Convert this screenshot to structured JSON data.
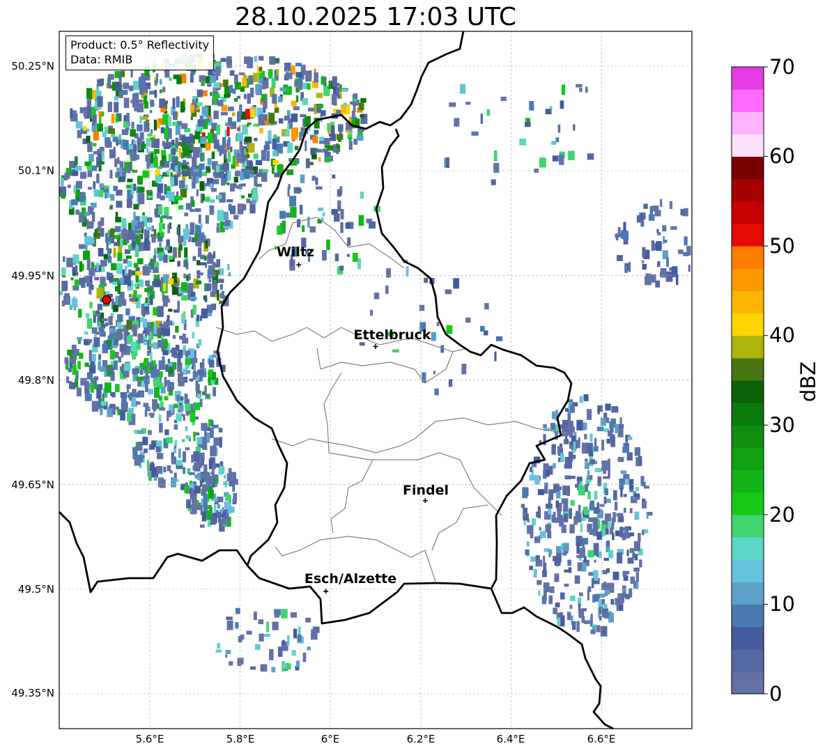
{
  "title": "28.10.2025 17:03 UTC",
  "info": {
    "product": "Product: 0.5° Reflectivity",
    "data": "Data: RMIB"
  },
  "lat_ticks": [
    "50.25°N",
    "50.1°N",
    "49.95°N",
    "49.8°N",
    "49.65°N",
    "49.5°N",
    "49.35°N"
  ],
  "lon_ticks": [
    "5.6°E",
    "5.8°E",
    "6°E",
    "6.2°E",
    "6.4°E",
    "6.6°E"
  ],
  "lat_values": [
    50.25,
    50.1,
    49.95,
    49.8,
    49.65,
    49.5,
    49.35
  ],
  "lon_values": [
    5.6,
    5.8,
    6.0,
    6.2,
    6.4,
    6.6
  ],
  "extent": {
    "lon_min": 5.4,
    "lon_max": 6.8,
    "lat_min": 49.3,
    "lat_max": 50.3
  },
  "colorbar": {
    "label": "dBZ",
    "ticks": [
      "0",
      "10",
      "20",
      "30",
      "40",
      "50",
      "60",
      "70"
    ],
    "colors": [
      "#6271a6",
      "#5567a0",
      "#445c9e",
      "#4a7ab1",
      "#5ba0c8",
      "#64c3dd",
      "#5ed6c5",
      "#3ed66c",
      "#16c917",
      "#12b515",
      "#0fa10f",
      "#0e8d0e",
      "#0c790c",
      "#0b6108",
      "#477611",
      "#adb30a",
      "#fed501",
      "#fdb502",
      "#fe9900",
      "#fe7d00",
      "#e60a02",
      "#c60002",
      "#a60001",
      "#790000",
      "#ffe2ff",
      "#ffb3ff",
      "#ff6bff",
      "#e63be5"
    ]
  },
  "cities": [
    {
      "name": "Wiltz",
      "lon": 5.93,
      "lat": 49.965
    },
    {
      "name": "Ettelbruck",
      "lon": 6.1,
      "lat": 49.848
    },
    {
      "name": "Findel",
      "lon": 6.21,
      "lat": 49.627
    },
    {
      "name": "Esch/Alzette",
      "lon": 5.99,
      "lat": 49.497
    }
  ],
  "radar_site": {
    "lon": 5.505,
    "lat": 49.915,
    "color": "#e00000"
  },
  "echo_regions": [
    {
      "lon": 5.75,
      "lat": 50.18,
      "rlon": 0.33,
      "rlat": 0.09,
      "n": 650,
      "maxI": 20
    },
    {
      "lon": 5.62,
      "lat": 50.08,
      "rlon": 0.22,
      "rlat": 0.08,
      "n": 350,
      "maxI": 14
    },
    {
      "lon": 5.58,
      "lat": 49.95,
      "rlon": 0.2,
      "rlat": 0.08,
      "n": 380,
      "maxI": 16
    },
    {
      "lon": 5.58,
      "lat": 49.82,
      "rlon": 0.18,
      "rlat": 0.07,
      "n": 340,
      "maxI": 11
    },
    {
      "lon": 5.66,
      "lat": 49.71,
      "rlon": 0.1,
      "rlat": 0.06,
      "n": 120,
      "maxI": 9
    },
    {
      "lon": 5.73,
      "lat": 49.64,
      "rlon": 0.06,
      "rlat": 0.05,
      "n": 110,
      "maxI": 10
    },
    {
      "lon": 6.56,
      "lat": 49.61,
      "rlon": 0.14,
      "rlat": 0.17,
      "n": 420,
      "maxI": 7
    },
    {
      "lon": 5.98,
      "lat": 50.03,
      "rlon": 0.12,
      "rlat": 0.08,
      "n": 55,
      "maxI": 10
    },
    {
      "lon": 5.85,
      "lat": 49.43,
      "rlon": 0.12,
      "rlat": 0.05,
      "n": 50,
      "maxI": 9
    },
    {
      "lon": 6.72,
      "lat": 50.0,
      "rlon": 0.1,
      "rlat": 0.06,
      "n": 60,
      "maxI": 4
    },
    {
      "lon": 6.4,
      "lat": 50.17,
      "rlon": 0.2,
      "rlat": 0.1,
      "n": 35,
      "maxI": 9
    },
    {
      "lon": 6.22,
      "lat": 49.88,
      "rlon": 0.18,
      "rlat": 0.1,
      "n": 30,
      "maxI": 9
    }
  ]
}
